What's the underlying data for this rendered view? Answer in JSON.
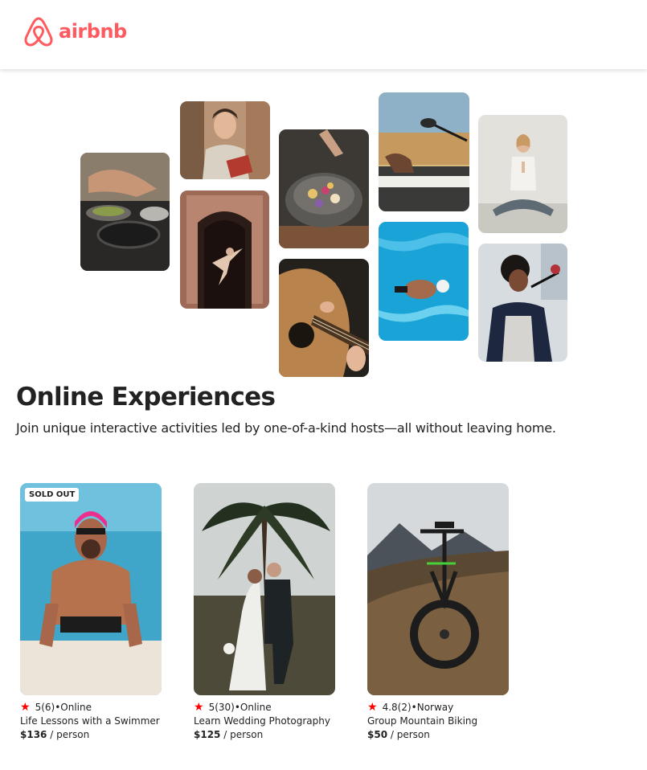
{
  "brand": {
    "name": "airbnb",
    "color": "#ff5a5f"
  },
  "hero": {
    "tiles": [
      "cooking-pans-photo",
      "host-with-book-photo",
      "dancer-in-doorway-photo",
      "bowl-of-food-photo",
      "acoustic-guitar-photo",
      "keyboard-and-microphone-photo",
      "swimmer-in-pool-photo",
      "yoga-meditation-photo",
      "singer-with-microphone-photo"
    ]
  },
  "section": {
    "title": "Online Experiences",
    "subtitle": "Join unique interactive activities led by one-of-a-kind hosts—all without leaving home."
  },
  "cards": [
    {
      "badge": "SOLD OUT",
      "rating": "5",
      "reviews": "(6)",
      "separator": "•",
      "location": "Online",
      "title": "Life Lessons with a Swimmer",
      "price": "$136",
      "per": " / person",
      "image": "swimmer-photo"
    },
    {
      "badge": "",
      "rating": "5",
      "reviews": "(30)",
      "separator": "•",
      "location": "Online",
      "title": "Learn Wedding Photography",
      "price": "$125",
      "per": " / person",
      "image": "wedding-couple-photo"
    },
    {
      "badge": "",
      "rating": "4.8",
      "reviews": "(2)",
      "separator": "•",
      "location": "Norway",
      "title": "Group Mountain Biking",
      "price": "$50",
      "per": " / person",
      "image": "mountain-bike-photo"
    }
  ],
  "colors": {
    "star": "#fe0000",
    "text": "#222222"
  }
}
